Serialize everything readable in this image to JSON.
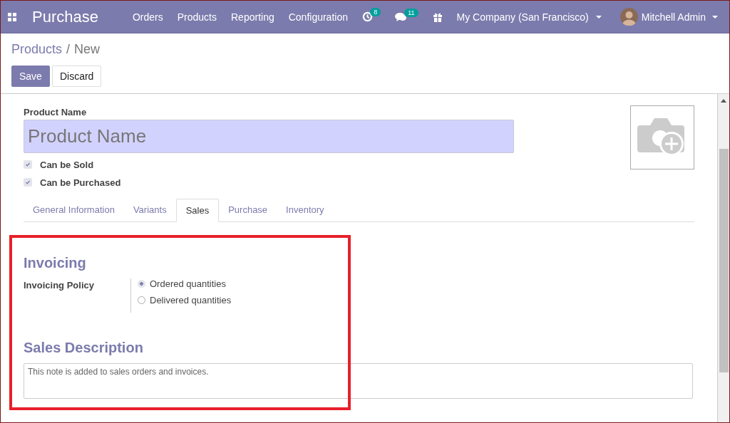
{
  "navbar": {
    "app_name": "Purchase",
    "menu": [
      {
        "label": "Orders"
      },
      {
        "label": "Products"
      },
      {
        "label": "Reporting"
      },
      {
        "label": "Configuration"
      }
    ],
    "activity_count": "8",
    "message_count": "11",
    "company": "My Company (San Francisco)",
    "user": "Mitchell Admin"
  },
  "breadcrumb": {
    "parent": "Products",
    "separator": "/",
    "current": "New"
  },
  "buttons": [
    {
      "label": "Save",
      "kind": "primary"
    },
    {
      "label": "Discard",
      "kind": "secondary"
    }
  ],
  "form": {
    "name_label": "Product Name",
    "name_placeholder": "Product Name",
    "checkboxes": [
      {
        "label": "Can be Sold",
        "checked": true
      },
      {
        "label": "Can be Purchased",
        "checked": true
      }
    ],
    "tabs": [
      {
        "label": "General Information",
        "selected": false
      },
      {
        "label": "Variants",
        "selected": false
      },
      {
        "label": "Sales",
        "selected": true
      },
      {
        "label": "Purchase",
        "selected": false
      },
      {
        "label": "Inventory",
        "selected": false
      }
    ],
    "invoicing": {
      "title": "Invoicing",
      "policy_label": "Invoicing Policy",
      "options": [
        {
          "label": "Ordered quantities",
          "selected": true
        },
        {
          "label": "Delivered quantities",
          "selected": false
        }
      ]
    },
    "sales_description": {
      "title": "Sales Description",
      "placeholder": "This note is added to sales orders and invoices."
    }
  }
}
